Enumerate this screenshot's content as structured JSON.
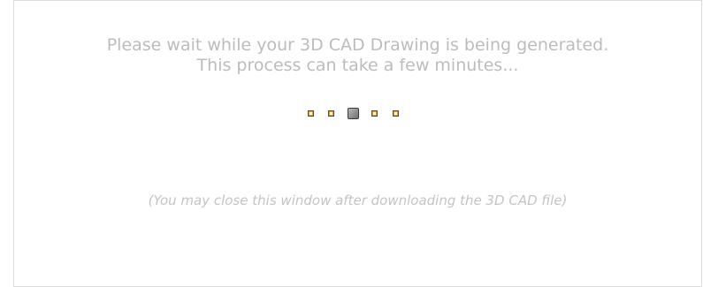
{
  "loading": {
    "message_line1": "Please wait while your 3D CAD Drawing is being generated.",
    "message_line2": "This process can take a few minutes...",
    "indicator_active_index": 3,
    "indicator_count": 5,
    "note": "(You may close this window after downloading the 3D CAD file)"
  },
  "colors": {
    "text": "#bcbcbc",
    "dot_accent": "#f5a20f",
    "active_dot": "#8d8d8d",
    "border": "#dcdcdc"
  }
}
